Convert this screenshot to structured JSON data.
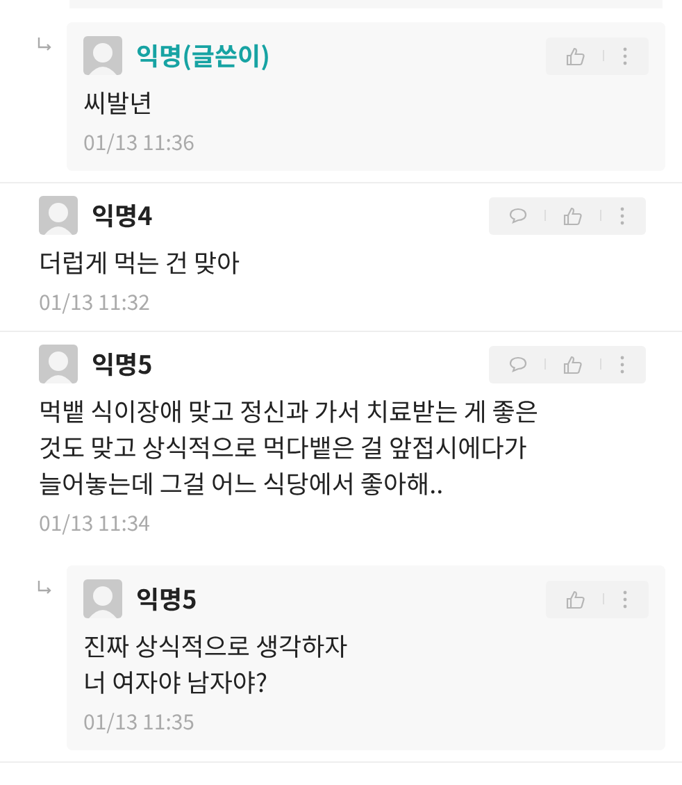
{
  "comments": [
    {
      "kind": "reply",
      "author": "익명(글쓴이)",
      "is_writer": true,
      "lines": [
        "씨발년"
      ],
      "time": "01/13 11:36",
      "can_reply": false
    },
    {
      "kind": "comment",
      "author": "익명4",
      "is_writer": false,
      "lines": [
        "더럽게 먹는 건 맞아"
      ],
      "time": "01/13 11:32",
      "can_reply": true
    },
    {
      "kind": "comment",
      "author": "익명5",
      "is_writer": false,
      "lines": [
        "먹뱉 식이장애 맞고 정신과 가서 치료받는 게 좋은",
        "것도 맞고 상식적으로 먹다뱉은 걸 앞접시에다가",
        "늘어놓는데 그걸 어느 식당에서 좋아해.."
      ],
      "time": "01/13 11:34",
      "can_reply": true
    },
    {
      "kind": "reply",
      "author": "익명5",
      "is_writer": false,
      "lines": [
        "진짜 상식적으로 생각하자",
        "너 여자야 남자야?"
      ],
      "time": "01/13 11:35",
      "can_reply": false
    }
  ]
}
